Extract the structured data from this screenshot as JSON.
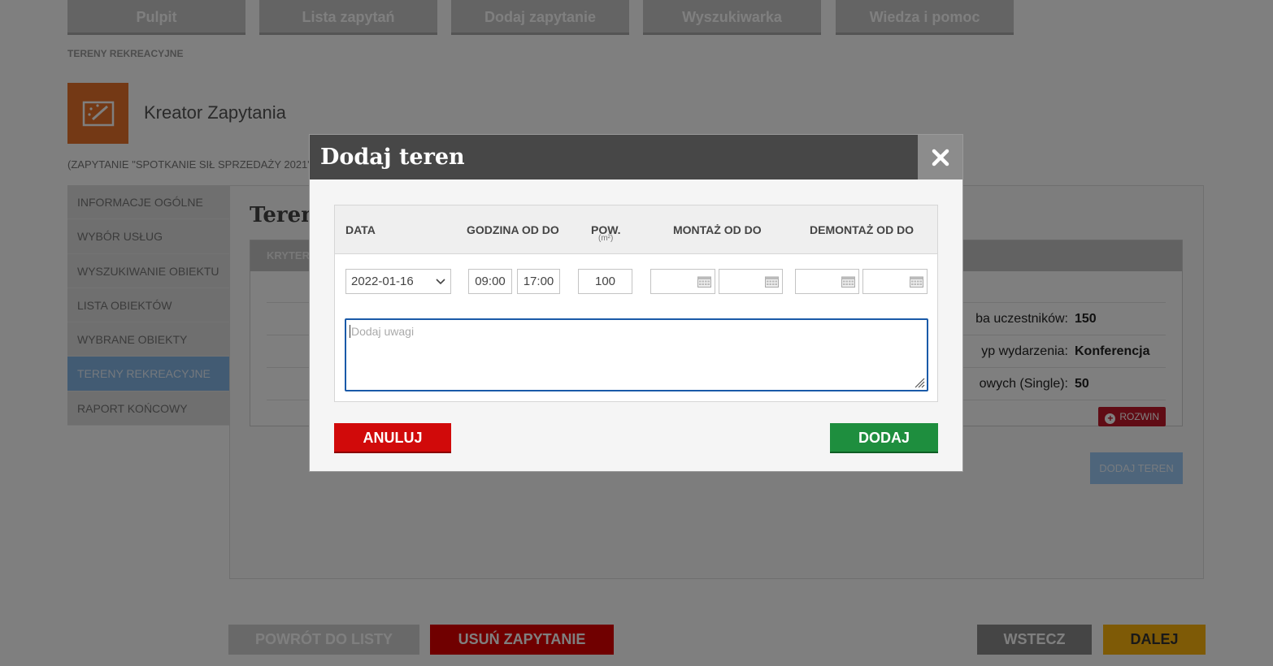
{
  "top_nav": [
    "Pulpit",
    "Lista zapytań",
    "Dodaj zapytanie",
    "Wyszukiwarka",
    "Wiedza i pomoc"
  ],
  "breadcrumb": "TERENY REKREACYJNE",
  "wizard": {
    "title": "Kreator Zapytania",
    "icon": "magic-wand-icon",
    "subtitle": "(ZAPYTANIE \"SPOTKANIE SIŁ SPRZEDAŻY 2021\""
  },
  "sidebar": {
    "items": [
      "INFORMACJE OGÓLNE",
      "WYBÓR USŁUG",
      "WYSZUKIWANIE OBIEKTU",
      "LISTA OBIEKTÓW",
      "WYBRANE OBIEKTY",
      "TERENY REKREACYJNE",
      "RAPORT KOŃCOWY"
    ],
    "active": "TERENY REKREACYJNE"
  },
  "main": {
    "title": "Teren",
    "criteria_header": "KRYTER",
    "rows": [
      {
        "label": "ba uczestników:",
        "value": "150"
      },
      {
        "label": "yp wydarzenia:",
        "value": "Konferencja"
      },
      {
        "label": "owych (Single):",
        "value": "50"
      }
    ],
    "expand_label": "ROZWIN",
    "add_area_label": "DODAJ TEREN"
  },
  "bottom_buttons": {
    "back_to_list": "POWRÓT DO LISTY",
    "delete": "USUŃ ZAPYTANIE",
    "back": "WSTECZ",
    "next": "DALEJ"
  },
  "modal": {
    "title": "Dodaj teren",
    "close_icon": "close-icon",
    "columns": {
      "date": "DATA",
      "hours": "GODZINA OD DO",
      "area": "POW.",
      "area_unit": "(m²)",
      "assembly": "MONTAŻ OD DO",
      "disassembly": "DEMONTAŻ OD DO"
    },
    "date_value": "2022-01-16",
    "time_from": "09:00",
    "time_to": "17:00",
    "area_value": "100",
    "notes_placeholder": "Dodaj uwagi",
    "cancel_label": "ANULUJ",
    "add_label": "DODAJ"
  },
  "colors": {
    "modal_header": "#474747",
    "cancel": "#d10a0a",
    "add": "#1e8e3e",
    "focus": "#1a5aa8"
  }
}
